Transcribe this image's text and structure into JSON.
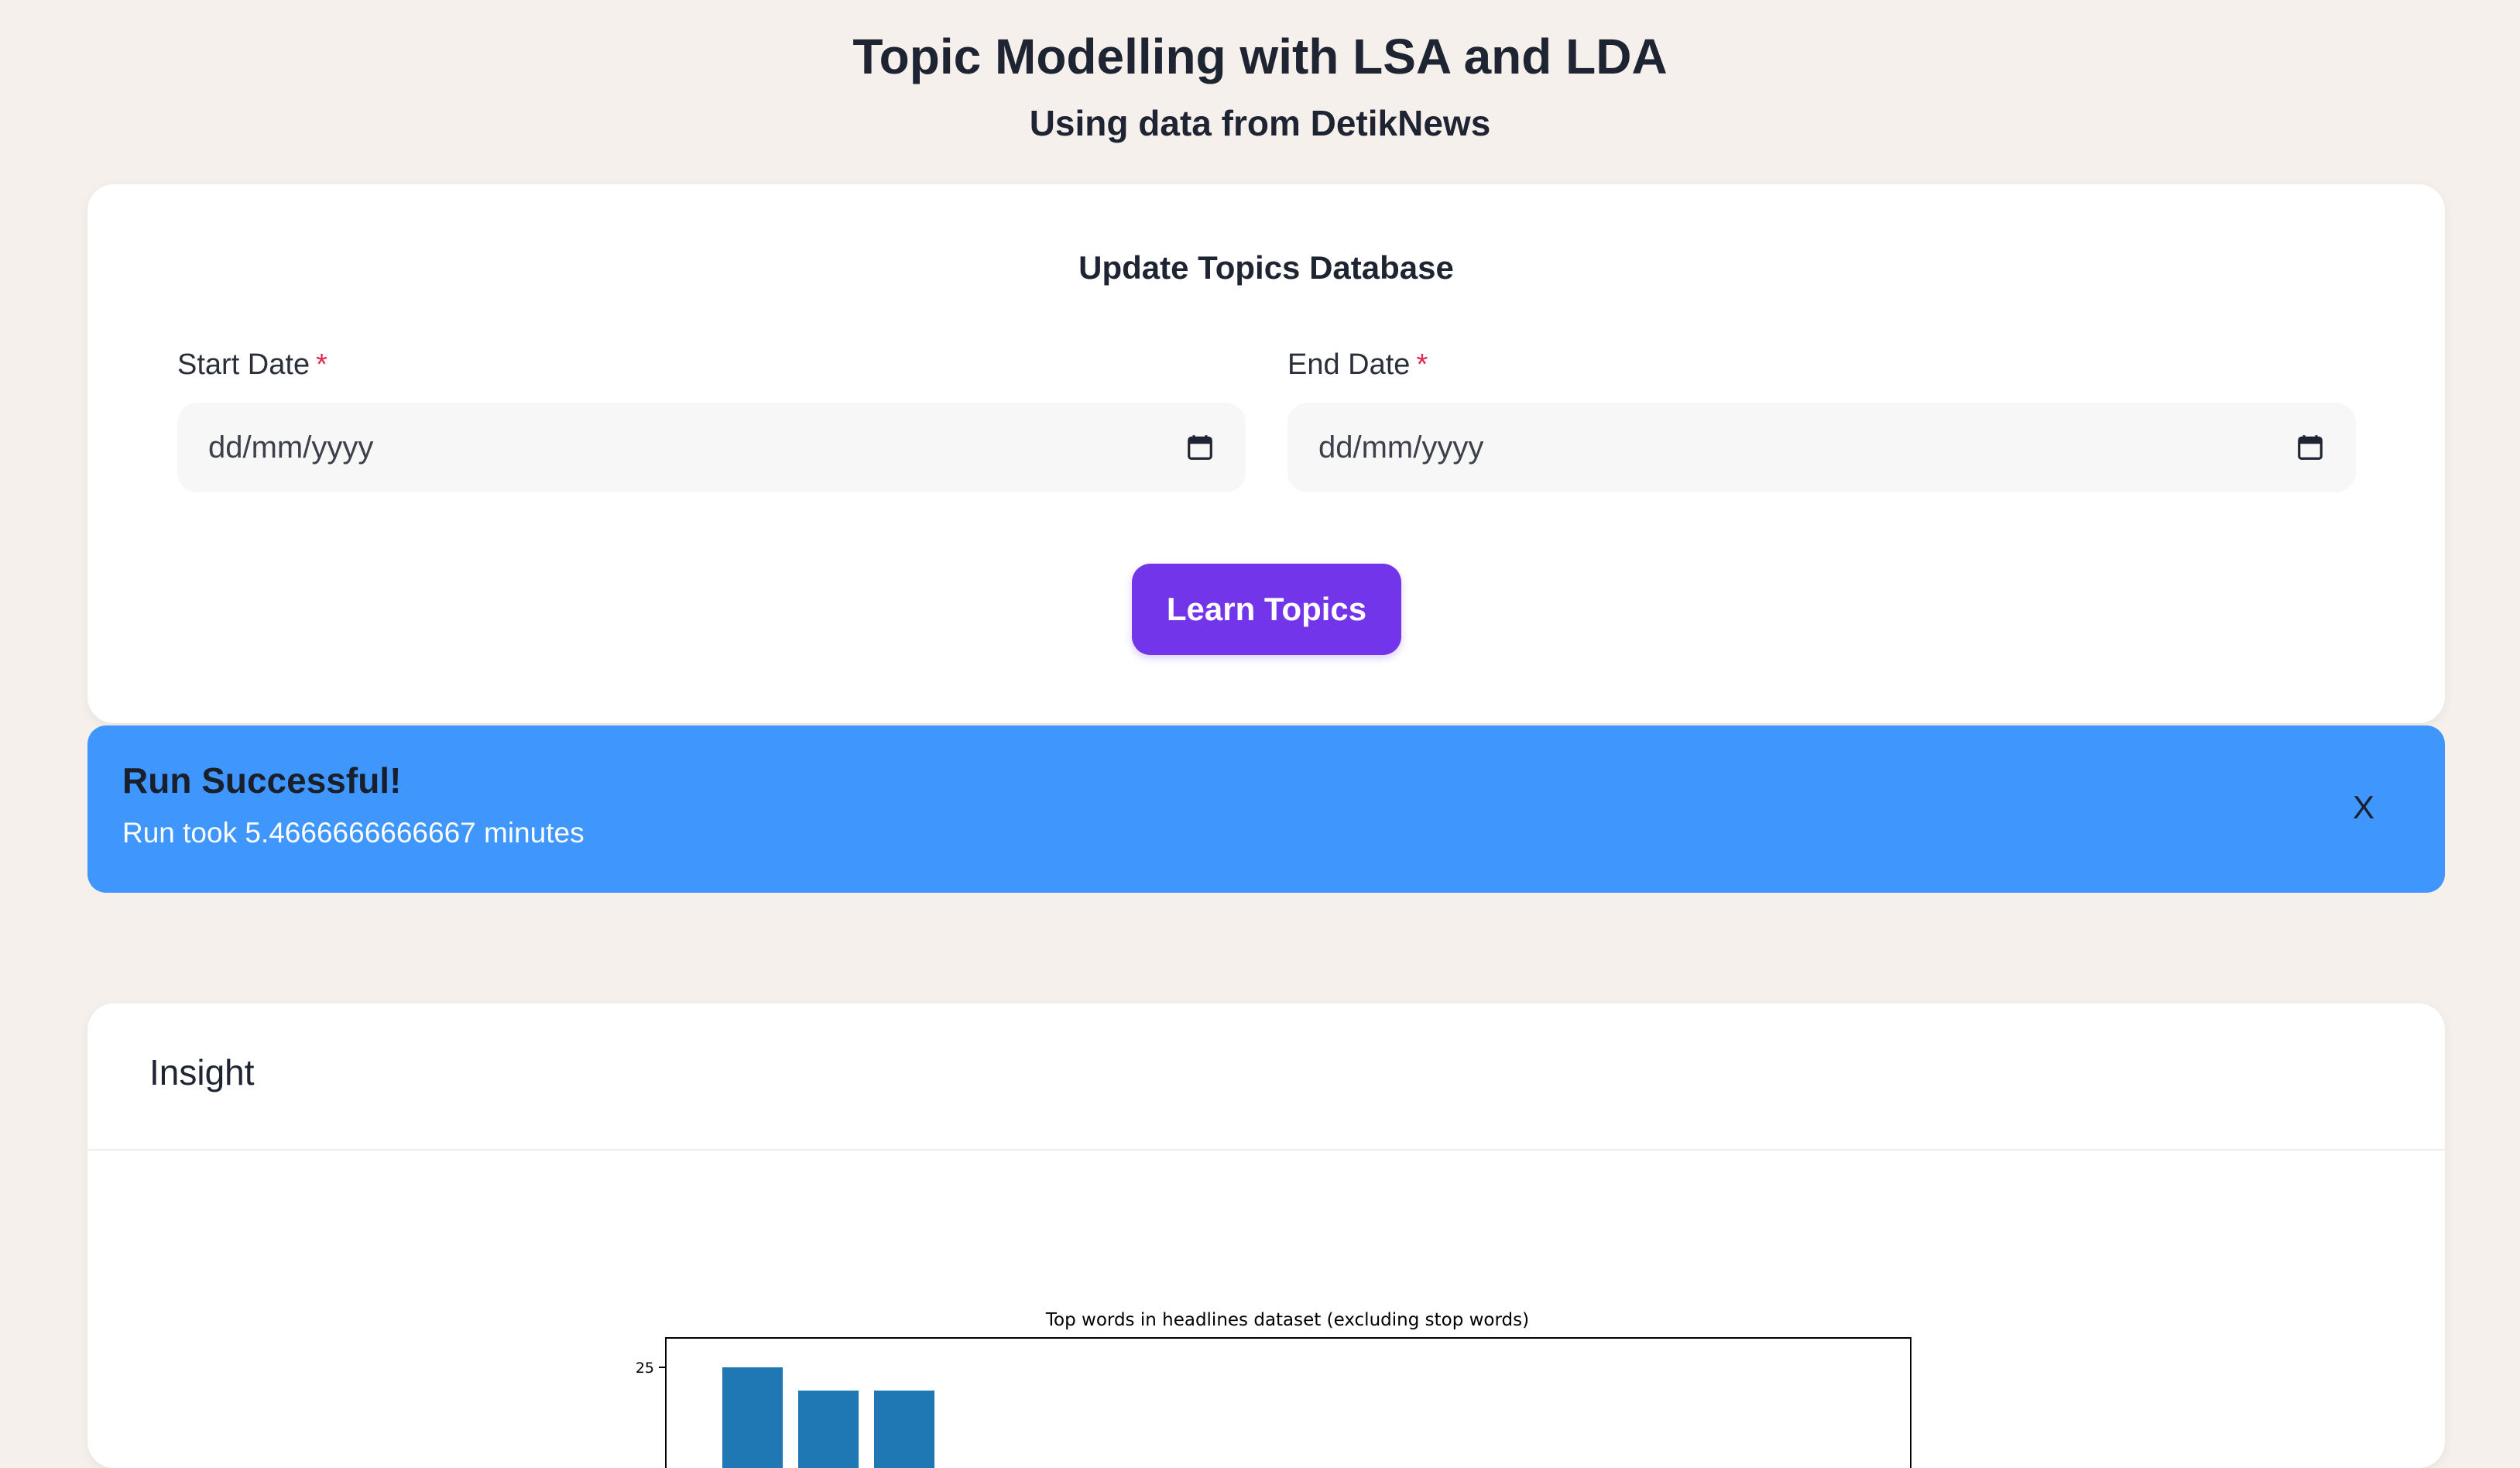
{
  "header": {
    "title": "Topic Modelling with LSA and LDA",
    "subtitle": "Using data from DetikNews"
  },
  "form": {
    "title": "Update Topics Database",
    "start_label": "Start Date",
    "end_label": "End Date",
    "required_mark": "*",
    "start_value": "dd/mm/yyyy",
    "end_value": "dd/mm/yyyy",
    "submit_label": "Learn Topics",
    "accent_color": "#7335ea"
  },
  "alert": {
    "title": "Run Successful!",
    "message": "Run took 5.4666666666667 minutes",
    "close_label": "X",
    "color": "#3f96fd"
  },
  "insight": {
    "title": "Insight"
  },
  "chart_data": {
    "type": "bar",
    "title": "Top words in headlines dataset (excluding stop words)",
    "values": [
      25,
      22,
      22
    ],
    "y_ticks": [
      25
    ],
    "bar_color": "#1f77b4"
  }
}
